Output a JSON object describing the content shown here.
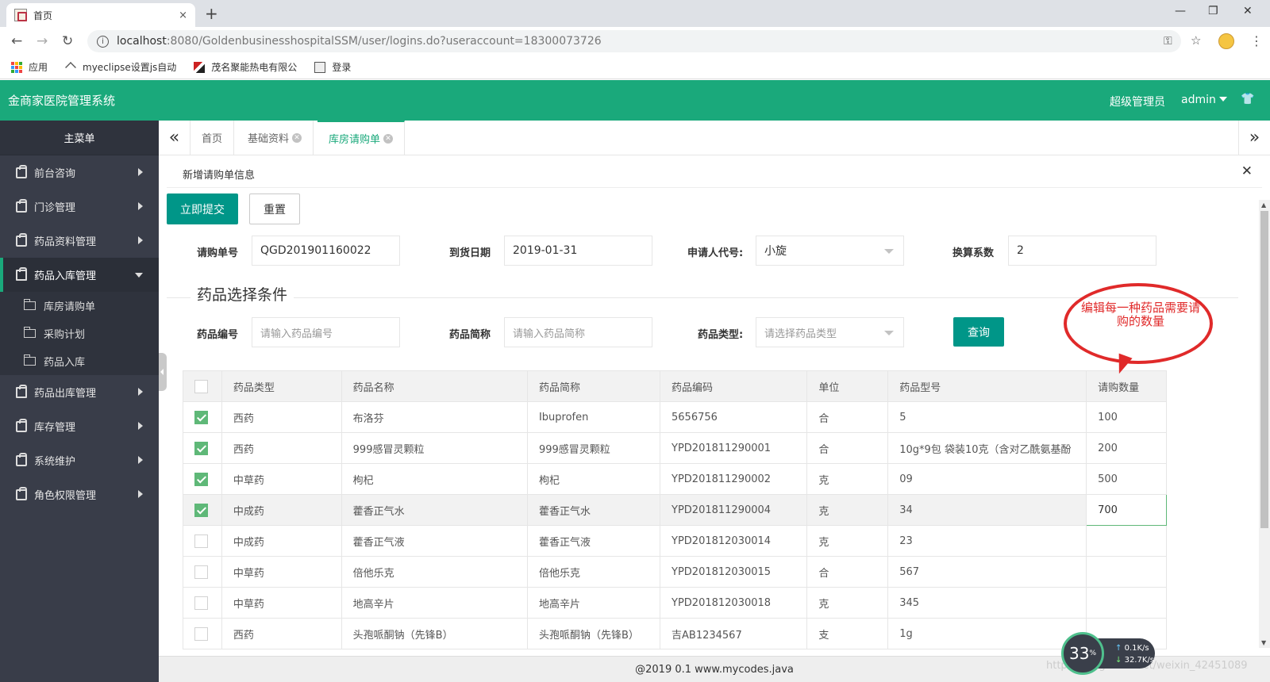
{
  "browser": {
    "tab_title": "首页",
    "tab_close": "×",
    "new_tab": "+",
    "url_host": "localhost",
    "url_rest": ":8080/GoldenbusinesshospitalSSM/user/logins.do?useraccount=18300073726",
    "window_controls": [
      "—",
      "❐",
      "✕"
    ],
    "bookmarks": [
      "应用",
      "myeclipse设置js自动",
      "茂名聚能热电有限公",
      "登录"
    ]
  },
  "header": {
    "app_title": "金商家医院管理系统",
    "role": "超级管理员",
    "user": "admin"
  },
  "sidebar": {
    "title": "主菜单",
    "items": [
      {
        "label": "前台咨询"
      },
      {
        "label": "门诊管理"
      },
      {
        "label": "药品资料管理"
      },
      {
        "label": "药品入库管理"
      },
      {
        "label": "药品出库管理"
      },
      {
        "label": "库存管理"
      },
      {
        "label": "系统维护"
      },
      {
        "label": "角色权限管理"
      }
    ],
    "sub_items": [
      "库房请购单",
      "采购计划",
      "药品入库"
    ]
  },
  "content_tabs": {
    "left_btn": "«",
    "right_btn": "»",
    "tabs": [
      {
        "label": "首页"
      },
      {
        "label": "基础资料"
      },
      {
        "label": "库房请购单"
      }
    ]
  },
  "panel": {
    "title": "新增请购单信息",
    "close": "✕",
    "submit_label": "立即提交",
    "reset_label": "重置"
  },
  "form": {
    "order_no_label": "请购单号",
    "order_no_value": "QGD201901160022",
    "arrival_label": "到货日期",
    "arrival_value": "2019-01-31",
    "applicant_label": "申请人代号:",
    "applicant_value": "小旋",
    "factor_label": "换算系数",
    "factor_value": "2"
  },
  "filter": {
    "legend": "药品选择条件",
    "code_label": "药品编号",
    "code_placeholder": "请输入药品编号",
    "abbr_label": "药品简称",
    "abbr_placeholder": "请输入药品简称",
    "type_label": "药品类型:",
    "type_placeholder": "请选择药品类型",
    "query_label": "查询"
  },
  "table": {
    "headers": [
      "药品类型",
      "药品名称",
      "药品简称",
      "药品编码",
      "单位",
      "药品型号",
      "请购数量"
    ],
    "rows": [
      {
        "checked": true,
        "cells": [
          "西药",
          "布洛芬",
          "Ibuprofen",
          "5656756",
          "合",
          "5",
          "100"
        ]
      },
      {
        "checked": true,
        "cells": [
          "西药",
          "999感冒灵颗粒",
          "999感冒灵颗粒",
          "YPD201811290001",
          "合",
          "10g*9包 袋装10克（含对乙酰氨基酚",
          "200"
        ]
      },
      {
        "checked": true,
        "cells": [
          "中草药",
          "枸杞",
          "枸杞",
          "YPD201811290002",
          "克",
          "09",
          "500"
        ]
      },
      {
        "checked": true,
        "cells": [
          "中成药",
          "藿香正气水",
          "藿香正气水",
          "YPD201811290004",
          "克",
          "34",
          "700"
        ]
      },
      {
        "checked": false,
        "cells": [
          "中成药",
          "藿香正气液",
          "藿香正气液",
          "YPD201812030014",
          "克",
          "23",
          ""
        ]
      },
      {
        "checked": false,
        "cells": [
          "中草药",
          "倍他乐克",
          "倍他乐克",
          "YPD201812030015",
          "合",
          "567",
          ""
        ]
      },
      {
        "checked": false,
        "cells": [
          "中草药",
          "地高辛片",
          "地高辛片",
          "YPD201812030018",
          "克",
          "345",
          ""
        ]
      },
      {
        "checked": false,
        "cells": [
          "西药",
          "头孢哌酮钠（先锋B）",
          "头孢哌酮钠（先锋B）",
          "吉AB1234567",
          "支",
          "1g",
          ""
        ]
      }
    ]
  },
  "annotation": {
    "text": "编辑每一种药品需要请购的数量"
  },
  "footer": {
    "text": "@2019 0.1 www.mycodes.java",
    "watermark": "https://blog.csdn.net/weixin_42451089"
  },
  "net_widget": {
    "percent": "33",
    "percent_unit": "%",
    "up": "0.1K/s",
    "down": "32.7K/s"
  },
  "colors": {
    "brand": "#1aa97b",
    "button": "#009688",
    "sidebar": "#393d49",
    "check": "#5fb878",
    "annotation": "#e02a2a"
  }
}
